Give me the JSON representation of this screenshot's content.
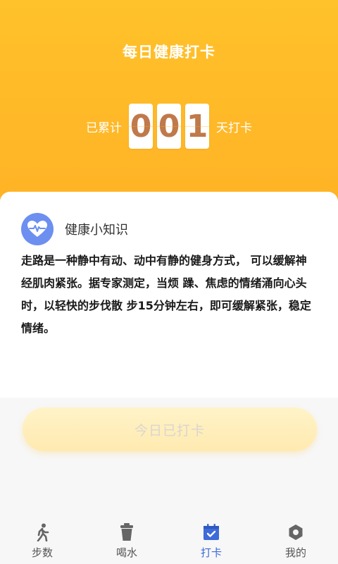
{
  "header": {
    "title": "每日健康打卡",
    "counter_prefix": "已累计",
    "counter_digits": [
      "0",
      "0",
      "1"
    ],
    "counter_suffix": "天打卡"
  },
  "tips": {
    "title": "健康小知识",
    "body": "走路是一种静中有动、动中有静的健身方式， 可以缓解神经肌肉紧张。据专家测定，当烦 躁、焦虑的情绪涌向心头时，以轻快的步伐散 步15分钟左右，即可缓解紧张，稳定情绪。"
  },
  "checkin_button": {
    "label": "今日已打卡"
  },
  "tabbar": {
    "active_color": "#3d6bd8",
    "items": [
      {
        "label": "步数",
        "icon": "walk-icon"
      },
      {
        "label": "喝水",
        "icon": "cup-icon"
      },
      {
        "label": "打卡",
        "icon": "calendar-check-icon"
      },
      {
        "label": "我的",
        "icon": "profile-gear-icon"
      }
    ]
  },
  "colors": {
    "header_bg": "#ffb226",
    "digit_text": "#c0794a",
    "icon_bg": "#6c8ff0"
  }
}
